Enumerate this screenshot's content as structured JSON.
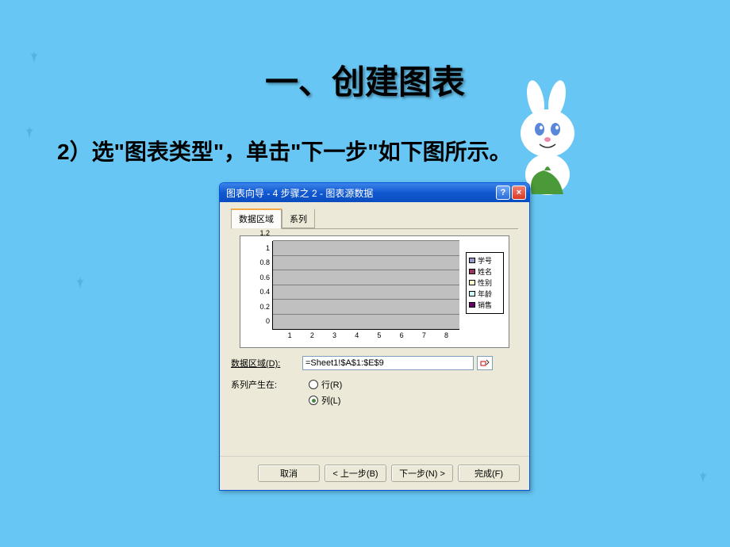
{
  "slide": {
    "title": "一、创建图表",
    "subtitle": "2）选\"图表类型\"，单击\"下一步\"如下图所示。"
  },
  "dialog": {
    "title": "图表向导 - 4 步骤之 2 - 图表源数据",
    "help_symbol": "?",
    "close_symbol": "×",
    "tabs": {
      "data_range": "数据区域",
      "series": "系列"
    },
    "form": {
      "data_range_label": "数据区域(D):",
      "data_range_value": "=Sheet1!$A$1:$E$9",
      "series_in_label": "系列产生在:",
      "row_label": "行(R)",
      "column_label": "列(L)"
    },
    "buttons": {
      "cancel": "取消",
      "back": "< 上一步(B)",
      "next": "下一步(N) >",
      "finish": "完成(F)"
    }
  },
  "chart_data": {
    "type": "bar",
    "title": "",
    "xlabel": "",
    "ylabel": "",
    "ylim": [
      0,
      1.2
    ],
    "yticks": [
      0,
      0.2,
      0.4,
      0.6,
      0.8,
      1,
      1.2
    ],
    "categories": [
      "1",
      "2",
      "3",
      "4",
      "5",
      "6",
      "7",
      "8"
    ],
    "series": [
      {
        "name": "学号",
        "color": "#9999cc",
        "values": [
          0,
          0,
          0,
          0,
          0,
          0,
          0,
          0
        ]
      },
      {
        "name": "姓名",
        "color": "#993366",
        "values": [
          0,
          0,
          0,
          0,
          0,
          0,
          0,
          0
        ]
      },
      {
        "name": "性别",
        "color": "#ffffcc",
        "values": [
          0,
          0,
          0,
          0,
          0,
          0,
          0,
          0
        ]
      },
      {
        "name": "年龄",
        "color": "#ccffff",
        "values": [
          0,
          0,
          0,
          0,
          0,
          0,
          0,
          0
        ]
      },
      {
        "name": "销售",
        "color": "#660066",
        "values": [
          0,
          0,
          0,
          0,
          0,
          0,
          0,
          0
        ]
      }
    ]
  }
}
